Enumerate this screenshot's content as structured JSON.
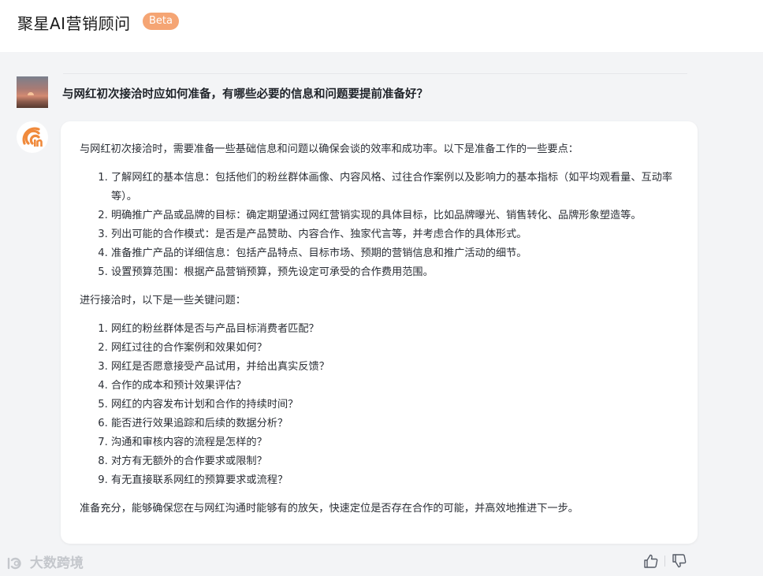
{
  "header": {
    "app_title": "聚星AI营销顾问",
    "badge": "Beta"
  },
  "conversation": {
    "question": "与网红初次接洽时应如何准备，有哪些必要的信息和问题要提前准备好？",
    "answer": {
      "intro": "与网红初次接洽时，需要准备一些基础信息和问题以确保会谈的效率和成功率。以下是准备工作的一些要点：",
      "prep_items": [
        "了解网红的基本信息：包括他们的粉丝群体画像、内容风格、过往合作案例以及影响力的基本指标（如平均观看量、互动率等）。",
        "明确推广产品或品牌的目标：确定期望通过网红营销实现的具体目标，比如品牌曝光、销售转化、品牌形象塑造等。",
        "列出可能的合作模式：是否是产品赞助、内容合作、独家代言等，并考虑合作的具体形式。",
        "准备推广产品的详细信息：包括产品特点、目标市场、预期的营销信息和推广活动的细节。",
        "设置预算范围：根据产品营销预算，预先设定可承受的合作费用范围。"
      ],
      "questions_intro": "进行接洽时，以下是一些关键问题：",
      "questions": [
        "网红的粉丝群体是否与产品目标消费者匹配？",
        "网红过往的合作案例和效果如何？",
        "网红是否愿意接受产品试用，并给出真实反馈？",
        "合作的成本和预计效果评估？",
        "网红的内容发布计划和合作的持续时间？",
        "能否进行效果追踪和后续的数据分析？",
        "沟通和审核内容的流程是怎样的？",
        "对方有无额外的合作要求或限制？",
        "有无直接联系网红的预算要求或流程？"
      ],
      "conclusion": "准备充分，能够确保您在与网红沟通时能够有的放矢，快速定位是否存在合作的可能，并高效地推进下一步。"
    }
  },
  "watermark": "大数跨境",
  "icons": {
    "bot_avatar": "wifi-logo-icon",
    "thumb_up": "thumb-up-icon",
    "thumb_down": "thumb-down-icon"
  },
  "colors": {
    "accent": "#f08a3c",
    "badge": "#f5a574",
    "background": "#f3f4f6"
  }
}
